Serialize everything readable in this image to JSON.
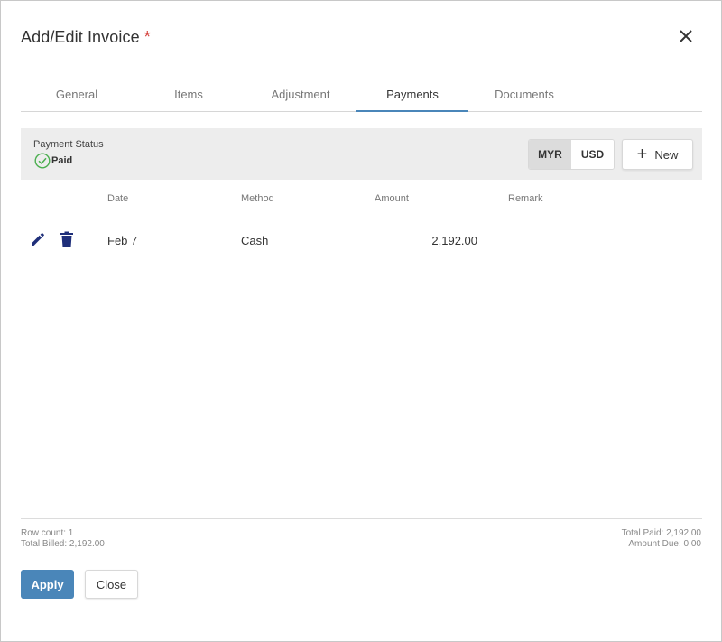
{
  "dialog": {
    "title": "Add/Edit Invoice",
    "required_marker": "*"
  },
  "tabs": [
    {
      "label": "General",
      "active": false
    },
    {
      "label": "Items",
      "active": false
    },
    {
      "label": "Adjustment",
      "active": false
    },
    {
      "label": "Payments",
      "active": true
    },
    {
      "label": "Documents",
      "active": false
    }
  ],
  "status": {
    "label": "Payment Status",
    "value": "Paid",
    "icon": "check-circle-icon",
    "icon_color": "#4caf50"
  },
  "currency": {
    "options": [
      "MYR",
      "USD"
    ],
    "selected": "MYR"
  },
  "toolbar": {
    "new_label": "New"
  },
  "table": {
    "columns": [
      "Date",
      "Method",
      "Amount",
      "Remark"
    ],
    "rows": [
      {
        "date": "Feb 7",
        "method": "Cash",
        "amount": "2,192.00",
        "remark": ""
      }
    ]
  },
  "footer": {
    "row_count": "Row count: 1",
    "total_billed": "Total Billed: 2,192.00",
    "total_paid": "Total Paid: 2,192.00",
    "amount_due": "Amount Due: 0.00"
  },
  "actions": {
    "apply_label": "Apply",
    "close_label": "Close"
  },
  "colors": {
    "accent": "#4a86b9",
    "icon_dark": "#1f2f7a",
    "required": "#d43f3a"
  }
}
